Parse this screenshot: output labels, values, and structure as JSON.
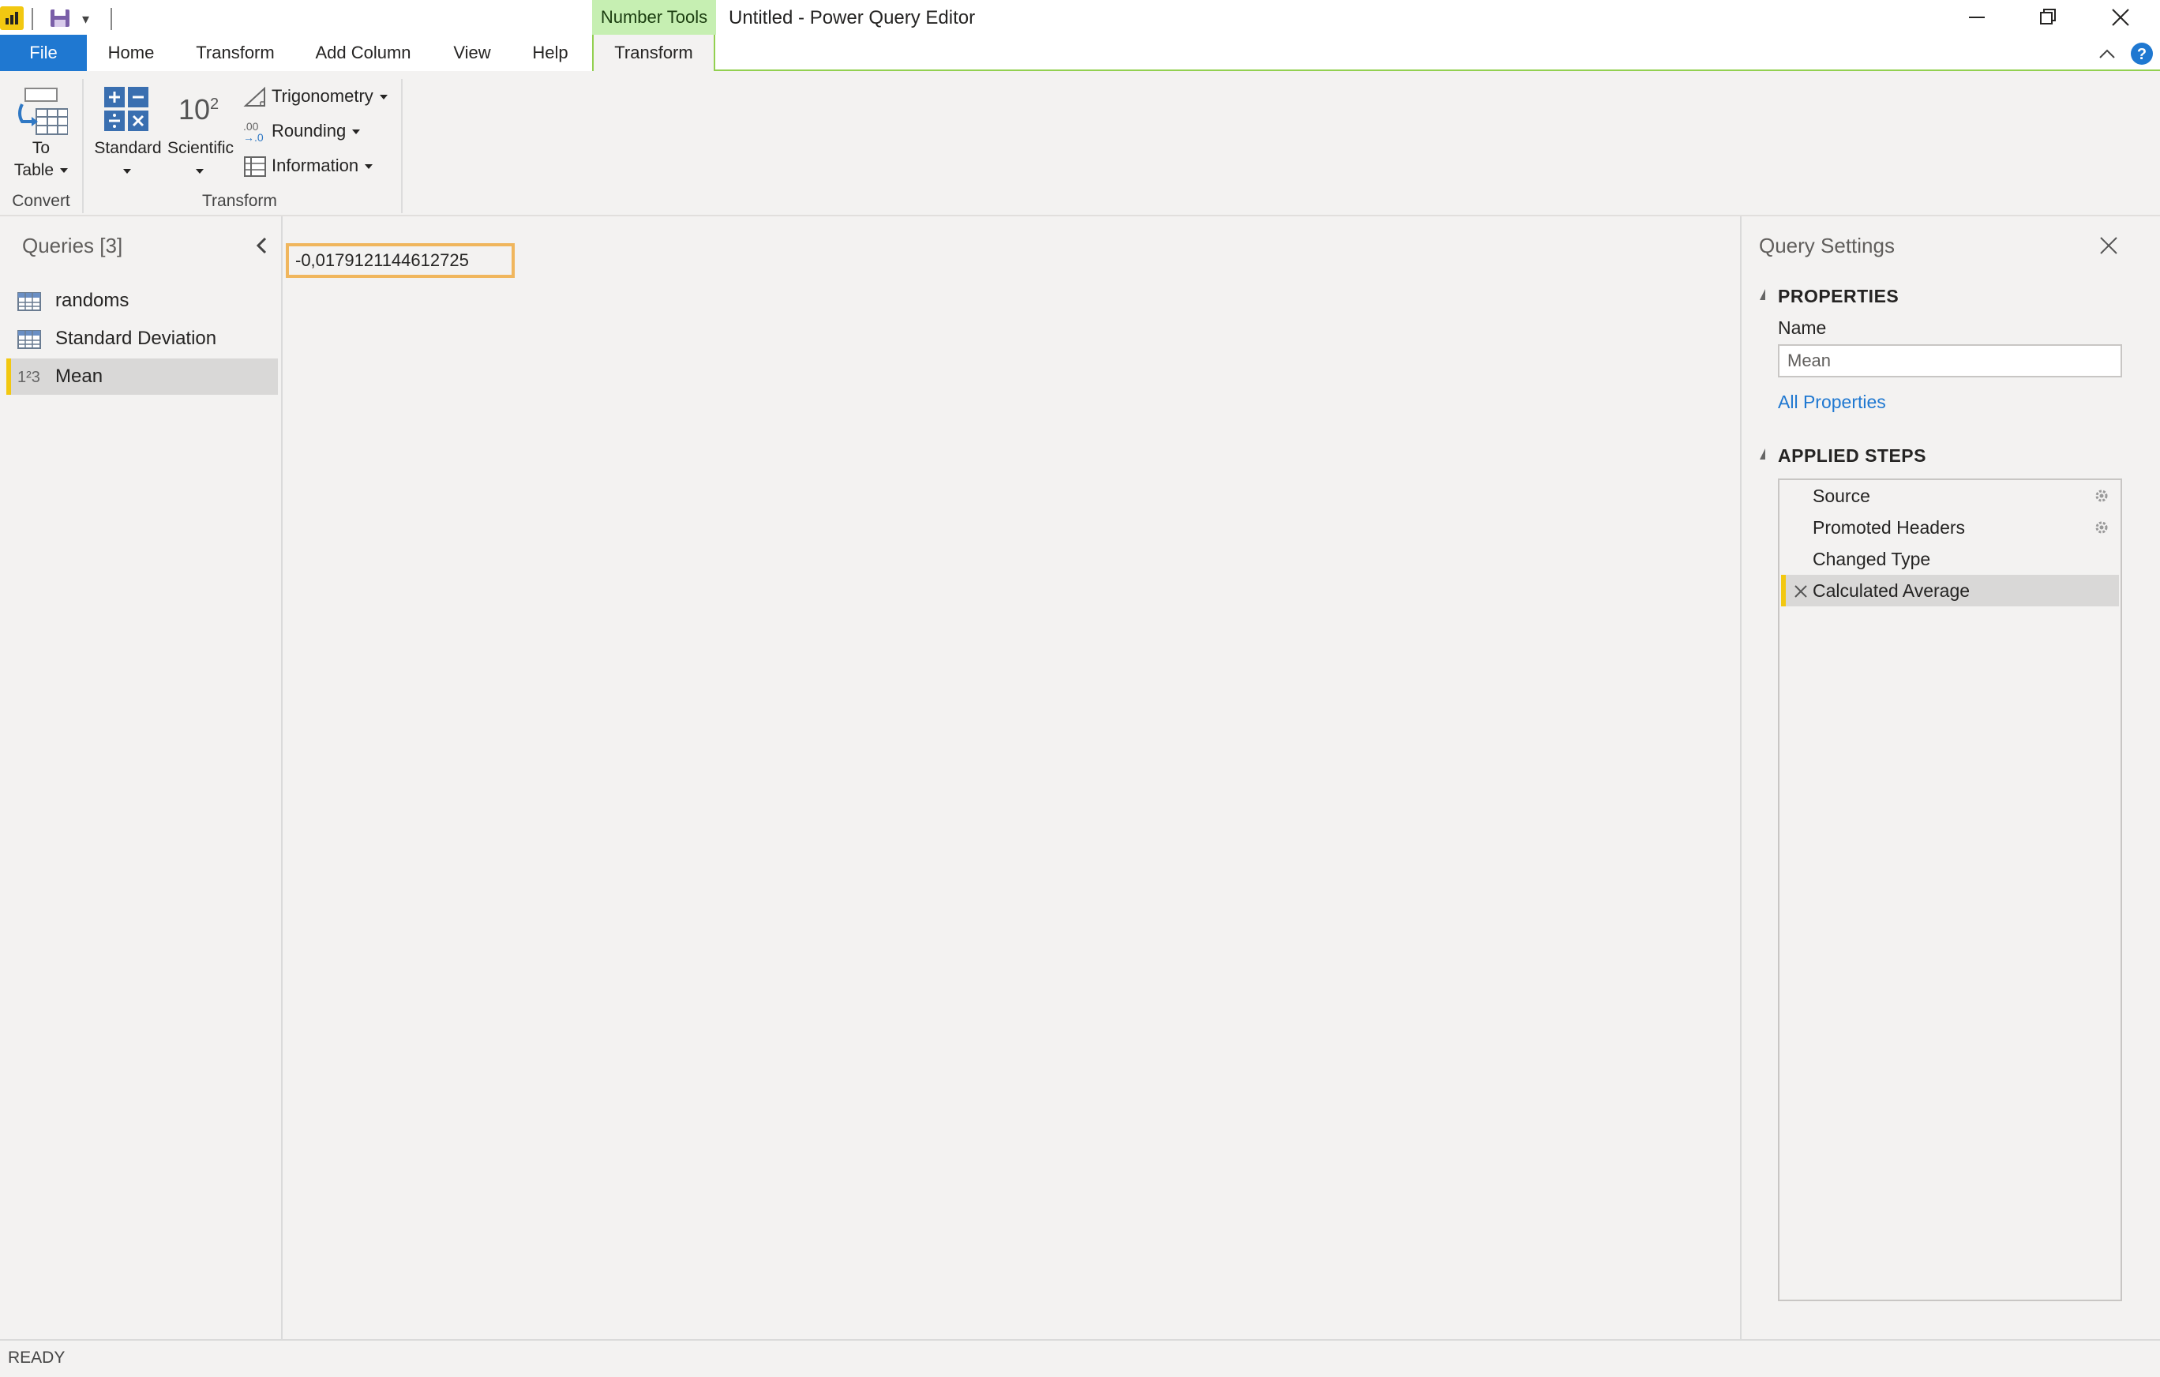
{
  "titlebar": {
    "context_group": "Number Tools",
    "window_title": "Untitled - Power Query Editor"
  },
  "tabs": {
    "file": "File",
    "home": "Home",
    "transform": "Transform",
    "add_column": "Add Column",
    "view": "View",
    "help": "Help",
    "context_transform": "Transform"
  },
  "ribbon": {
    "to_table_line1": "To",
    "to_table_line2": "Table",
    "convert_group": "Convert",
    "standard": "Standard",
    "scientific": "Scientific",
    "scientific_glyph_base": "10",
    "scientific_glyph_exp": "2",
    "trigonometry": "Trigonometry",
    "rounding": "Rounding",
    "rounding_glyph": ".00",
    "information": "Information",
    "transform_group": "Transform"
  },
  "queries": {
    "header": "Queries [3]",
    "items": [
      {
        "label": "randoms",
        "icon": "table-icon"
      },
      {
        "label": "Standard Deviation",
        "icon": "table-icon"
      },
      {
        "label": "Mean",
        "icon": "number-icon",
        "icon_glyph": "1²3"
      }
    ]
  },
  "main": {
    "value": "-0,0179121144612725"
  },
  "settings": {
    "title": "Query Settings",
    "properties_head": "PROPERTIES",
    "name_label": "Name",
    "name_value": "Mean",
    "all_properties": "All Properties",
    "steps_head": "APPLIED STEPS",
    "steps": [
      {
        "label": "Source",
        "has_gear": true
      },
      {
        "label": "Promoted Headers",
        "has_gear": true
      },
      {
        "label": "Changed Type",
        "has_gear": false
      },
      {
        "label": "Calculated Average",
        "has_gear": false,
        "selected": true
      }
    ]
  },
  "status": {
    "text": "READY"
  },
  "colors": {
    "accent_blue": "#1f78d1",
    "context_green": "#c6efb2",
    "selection_yellow": "#f2c811",
    "highlight_orange": "#f0b65d"
  }
}
